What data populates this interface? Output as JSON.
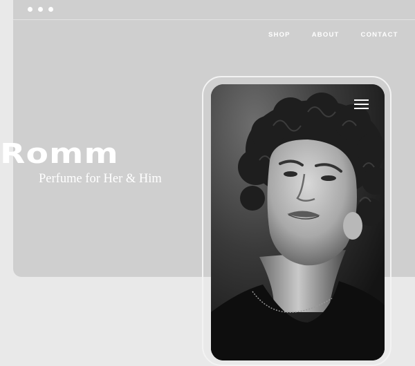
{
  "window": {
    "controls": [
      "dot",
      "dot",
      "dot"
    ]
  },
  "nav": {
    "items": [
      {
        "label": "SHOP"
      },
      {
        "label": "ABOUT"
      },
      {
        "label": "CONTACT"
      }
    ]
  },
  "hero": {
    "brand": "Romm",
    "tagline": "Perfume for Her & Him"
  },
  "phone": {
    "menu_icon": "hamburger-menu-icon",
    "image": "black-and-white portrait of curly-haired man"
  },
  "colors": {
    "page_bg": "#e9e9e9",
    "browser_bg": "#cfcfcf",
    "text": "#ffffff"
  }
}
